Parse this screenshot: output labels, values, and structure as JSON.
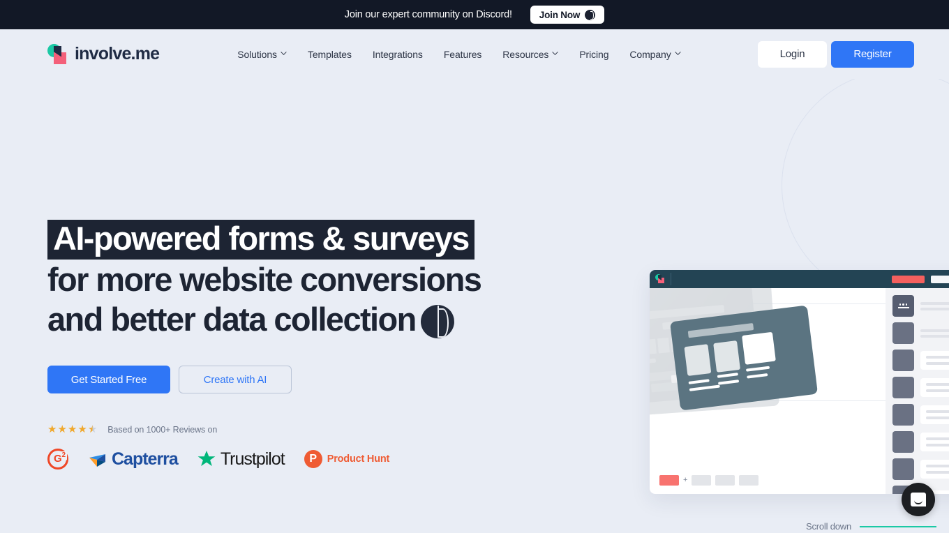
{
  "announcement": {
    "text": "Join our expert community on Discord!",
    "button_label": "Join Now",
    "button_icon": "involveme-sphere-icon",
    "background": "#121826"
  },
  "header": {
    "logo_text": "involve.me",
    "logo_colors": {
      "circle": "#1bc9a5",
      "square": "#f4607a",
      "wordmark": "#1f2b44"
    },
    "nav": [
      {
        "label": "Solutions",
        "has_dropdown": true
      },
      {
        "label": "Templates",
        "has_dropdown": false
      },
      {
        "label": "Integrations",
        "has_dropdown": false
      },
      {
        "label": "Features",
        "has_dropdown": false
      },
      {
        "label": "Resources",
        "has_dropdown": true
      },
      {
        "label": "Pricing",
        "has_dropdown": false
      },
      {
        "label": "Company",
        "has_dropdown": true
      }
    ],
    "login_label": "Login",
    "register_label": "Register",
    "register_color": "#2f76f6"
  },
  "hero": {
    "headline_line1": "AI-powered forms & surveys",
    "headline_line2": "for more website conversions",
    "headline_line3": "and better data collection",
    "headline_icon": "involveme-sphere-icon",
    "cta_primary": "Get Started Free",
    "cta_secondary": "Create with AI",
    "rating_stars": "4.5",
    "reviews_text": "Based on 1000+ Reviews on",
    "badges": [
      {
        "name": "G2",
        "mark": "G",
        "superscript": "2",
        "color": "#ef4726"
      },
      {
        "name": "Capterra",
        "label": "Capterra",
        "color": "#1e4fa0"
      },
      {
        "name": "Trustpilot",
        "label": "Trustpilot",
        "color": "#191919",
        "star_color": "#00b67a"
      },
      {
        "name": "Product Hunt",
        "label": "Product Hunt",
        "mark": "P",
        "color": "#ef5b33"
      }
    ]
  },
  "mockup": {
    "app_bar_color": "#234454",
    "accent_chip_color": "#f4605e",
    "active_page_color": "#f8736f",
    "page_plus": "+",
    "sidebar_tile_color": "#6a7183"
  },
  "footer": {
    "scroll_label": "Scroll down",
    "scroll_line_color": "#1bc9a5"
  },
  "chat": {
    "icon": "chat-bubble-icon"
  }
}
